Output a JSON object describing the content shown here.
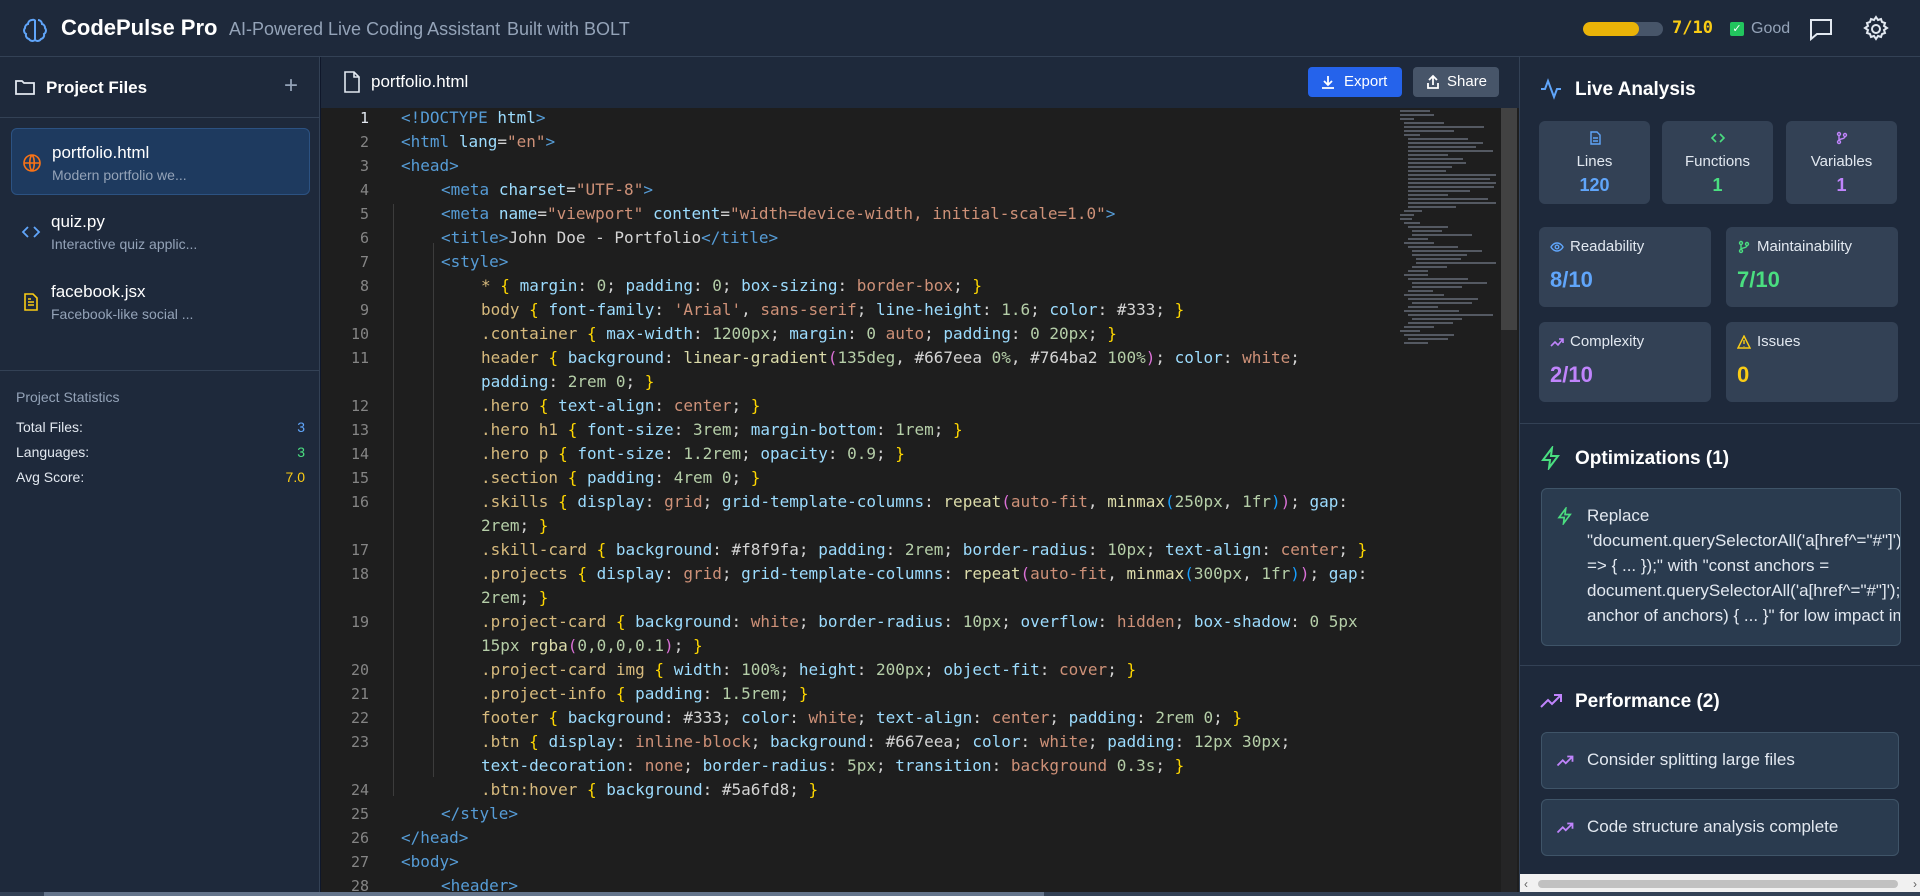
{
  "header": {
    "app_name": "CodePulse Pro",
    "tagline": "AI-Powered Live Coding Assistant",
    "built_with": "Built with BOLT",
    "score_text": "7/10",
    "score_fraction": 0.7,
    "status_text": "Good",
    "accent_color": "#eab308"
  },
  "sidebar": {
    "title": "Project Files",
    "files": [
      {
        "name": "portfolio.html",
        "desc": "Modern portfolio we...",
        "icon": "globe-icon"
      },
      {
        "name": "quiz.py",
        "desc": "Interactive quiz applic...",
        "icon": "code-icon"
      },
      {
        "name": "facebook.jsx",
        "desc": "Facebook-like social ...",
        "icon": "file-text-icon"
      }
    ],
    "stats": {
      "title": "Project Statistics",
      "rows": [
        {
          "label": "Total Files:",
          "value": "3"
        },
        {
          "label": "Languages:",
          "value": "3"
        },
        {
          "label": "Avg Score:",
          "value": "7.0"
        }
      ]
    }
  },
  "editor": {
    "filename": "portfolio.html",
    "export_label": "Export",
    "share_label": "Share",
    "line_numbers": [
      "1",
      "2",
      "3",
      "4",
      "5",
      "6",
      "7",
      "8",
      "9",
      "10",
      "11",
      "12",
      "13",
      "14",
      "15",
      "16",
      "17",
      "18",
      "19",
      "20",
      "21",
      "22",
      "23",
      "24",
      "25",
      "26",
      "27",
      "28"
    ]
  },
  "analysis": {
    "title": "Live Analysis",
    "metrics": [
      {
        "label": "Lines",
        "value": "120"
      },
      {
        "label": "Functions",
        "value": "1"
      },
      {
        "label": "Variables",
        "value": "1"
      }
    ],
    "scores": [
      {
        "label": "Readability",
        "value": "8/10"
      },
      {
        "label": "Maintainability",
        "value": "7/10"
      },
      {
        "label": "Complexity",
        "value": "2/10"
      },
      {
        "label": "Issues",
        "value": "0"
      }
    ]
  },
  "optimizations": {
    "title": "Optimizations (1)",
    "lines": [
      "Replace",
      "\"document.querySelectorAll('a[href^=\"#\"]')",
      "=> { ... });\" with \"const anchors =",
      "document.querySelectorAll('a[href^=\"#\"]');",
      "anchor of anchors) { ... }\" for low impact imp"
    ]
  },
  "performance": {
    "title": "Performance (2)",
    "items": [
      "Consider splitting large files",
      "Code structure analysis complete"
    ]
  }
}
